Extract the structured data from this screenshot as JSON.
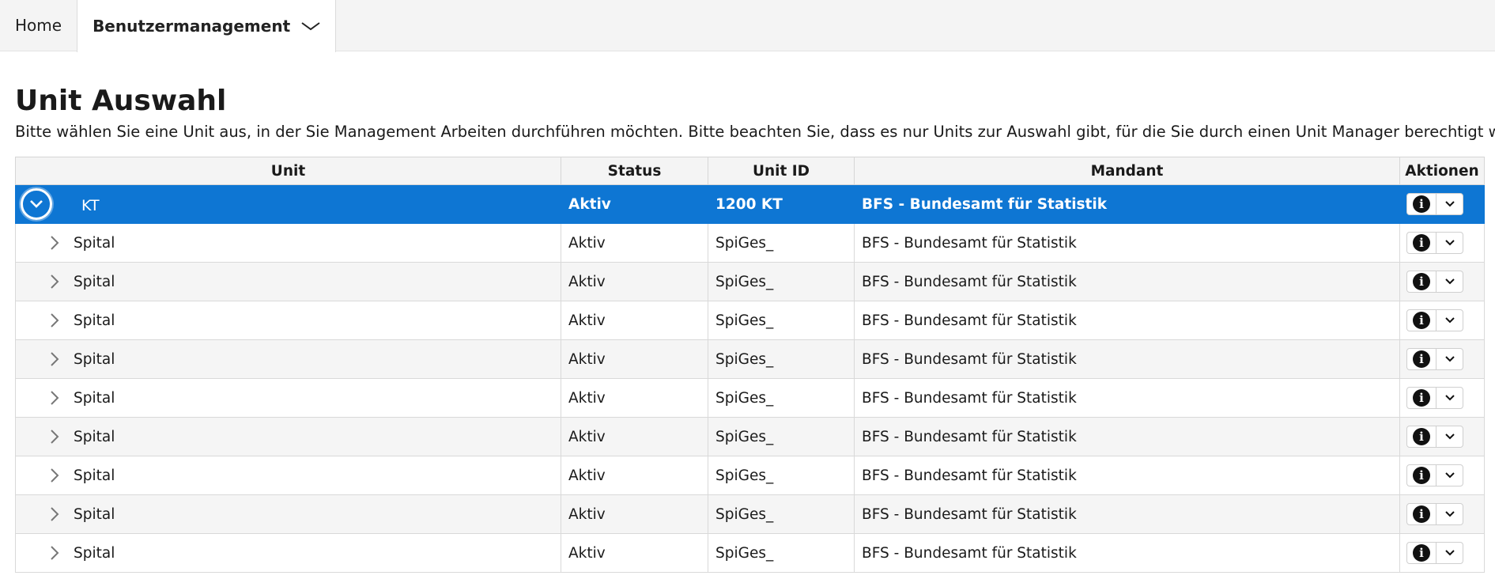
{
  "nav": {
    "home_label": "Home",
    "user_mgmt_label": "Benutzermanagement"
  },
  "page": {
    "title": "Unit Auswahl",
    "description": "Bitte wählen Sie eine Unit aus, in der Sie Management Arbeiten durchführen möchten. Bitte beachten Sie, dass es nur Units zur Auswahl gibt, für die Sie durch einen Unit Manager berechtigt wurden."
  },
  "table": {
    "columns": [
      "Unit",
      "Status",
      "Unit ID",
      "Mandant",
      "Aktionen"
    ],
    "selected_row": {
      "unit": "KT",
      "status": "Aktiv",
      "unit_id": "1200 KT",
      "mandant": "BFS - Bundesamt für Statistik"
    },
    "rows": [
      {
        "unit": "Spital",
        "status": "Aktiv",
        "unit_id": "SpiGes_",
        "mandant": "BFS - Bundesamt für Statistik"
      },
      {
        "unit": "Spital",
        "status": "Aktiv",
        "unit_id": "SpiGes_",
        "mandant": "BFS - Bundesamt für Statistik"
      },
      {
        "unit": "Spital",
        "status": "Aktiv",
        "unit_id": "SpiGes_",
        "mandant": "BFS - Bundesamt für Statistik"
      },
      {
        "unit": "Spital",
        "status": "Aktiv",
        "unit_id": "SpiGes_",
        "mandant": "BFS - Bundesamt für Statistik"
      },
      {
        "unit": "Spital",
        "status": "Aktiv",
        "unit_id": "SpiGes_",
        "mandant": "BFS - Bundesamt für Statistik"
      },
      {
        "unit": "Spital",
        "status": "Aktiv",
        "unit_id": "SpiGes_",
        "mandant": "BFS - Bundesamt für Statistik"
      },
      {
        "unit": "Spital",
        "status": "Aktiv",
        "unit_id": "SpiGes_",
        "mandant": "BFS - Bundesamt für Statistik"
      },
      {
        "unit": "Spital",
        "status": "Aktiv",
        "unit_id": "SpiGes_",
        "mandant": "BFS - Bundesamt für Statistik"
      },
      {
        "unit": "Spital",
        "status": "Aktiv",
        "unit_id": "SpiGes_",
        "mandant": "BFS - Bundesamt für Statistik"
      }
    ]
  },
  "icons": {
    "expand": "chevron-down-circle-icon",
    "child": "chevron-right-icon",
    "info": "info-icon",
    "menu": "chevron-down-icon"
  },
  "colors": {
    "selected_row": "#0e76d3",
    "header_bg": "#f4f4f4",
    "nav_bg": "#f4f4f4"
  }
}
